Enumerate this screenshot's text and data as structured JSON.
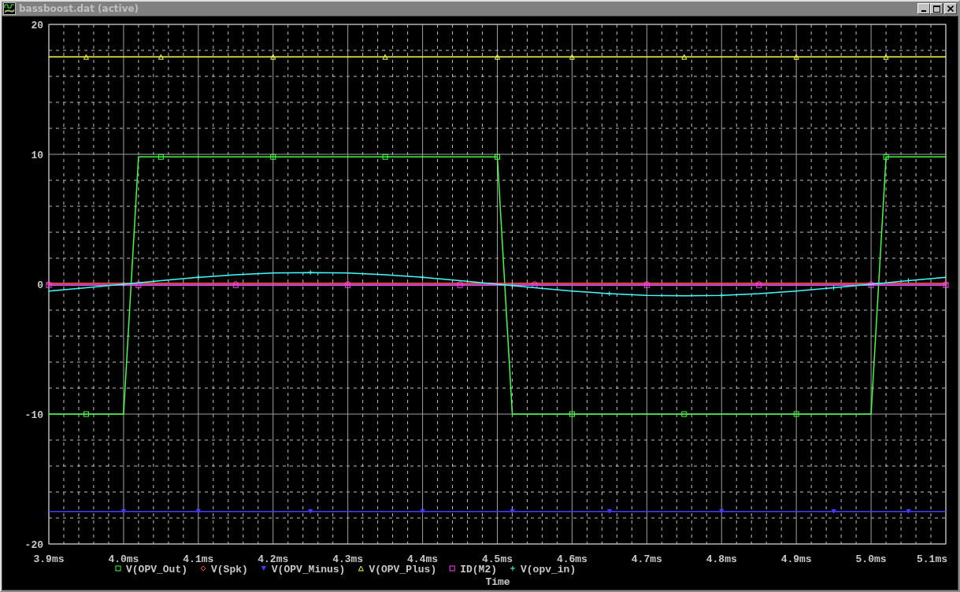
{
  "window": {
    "title": "bassboost.dat (active)"
  },
  "plot": {
    "chart_data": {
      "type": "line",
      "xlabel": "Time",
      "x": [
        3.9,
        3.95,
        4.0,
        4.02,
        4.05,
        4.1,
        4.15,
        4.2,
        4.25,
        4.3,
        4.35,
        4.4,
        4.45,
        4.5,
        4.52,
        4.55,
        4.6,
        4.65,
        4.7,
        4.75,
        4.8,
        4.85,
        4.9,
        4.95,
        5.0,
        5.02,
        5.05,
        5.1
      ],
      "series": [
        {
          "name": "V(OPV_Out)",
          "color": "#40ff40",
          "values": [
            -10,
            -10,
            -10,
            9.8,
            9.8,
            9.8,
            9.8,
            9.8,
            9.8,
            9.8,
            9.8,
            9.8,
            9.8,
            9.8,
            -10,
            -10,
            -10,
            -10,
            -10,
            -10,
            -10,
            -10,
            -10,
            -10,
            -10,
            9.8,
            9.8,
            9.8
          ]
        },
        {
          "name": "V(Spk)",
          "color": "#ff4040",
          "values": [
            0,
            0,
            0,
            0,
            0,
            0,
            0,
            0,
            0,
            0,
            0,
            0,
            0,
            0,
            0,
            0,
            0,
            0,
            0,
            0,
            0,
            0,
            0,
            0,
            0,
            0,
            0,
            0
          ]
        },
        {
          "name": "V(OPV_Minus)",
          "color": "#4040ff",
          "values": [
            -17.5,
            -17.5,
            -17.5,
            -17.5,
            -17.5,
            -17.5,
            -17.5,
            -17.5,
            -17.5,
            -17.5,
            -17.5,
            -17.5,
            -17.5,
            -17.5,
            -17.5,
            -17.5,
            -17.5,
            -17.5,
            -17.5,
            -17.5,
            -17.5,
            -17.5,
            -17.5,
            -17.5,
            -17.5,
            -17.5,
            -17.5,
            -17.5
          ]
        },
        {
          "name": "V(OPV_Plus)",
          "color": "#ffff40",
          "values": [
            17.5,
            17.5,
            17.5,
            17.5,
            17.5,
            17.5,
            17.5,
            17.5,
            17.5,
            17.5,
            17.5,
            17.5,
            17.5,
            17.5,
            17.5,
            17.5,
            17.5,
            17.5,
            17.5,
            17.5,
            17.5,
            17.5,
            17.5,
            17.5,
            17.5,
            17.5,
            17.5,
            17.5
          ]
        },
        {
          "name": "ID(M2)",
          "color": "#ff40ff",
          "values": [
            0,
            0,
            0,
            0,
            0,
            0,
            0,
            0,
            0,
            0,
            0,
            0,
            0,
            0,
            0,
            0,
            0,
            0,
            0,
            0,
            0,
            0,
            0,
            0,
            0,
            0,
            0,
            0
          ]
        },
        {
          "name": "V(opv_in)",
          "color": "#40ffff",
          "values": [
            -0.53,
            -0.28,
            0,
            0.11,
            0.28,
            0.53,
            0.73,
            0.86,
            0.9,
            0.86,
            0.73,
            0.53,
            0.28,
            0,
            -0.11,
            -0.28,
            -0.53,
            -0.73,
            -0.86,
            -0.9,
            -0.86,
            -0.73,
            -0.53,
            -0.28,
            0,
            0.11,
            0.28,
            0.53
          ]
        }
      ],
      "xlim": [
        3.9,
        5.1
      ],
      "ylim": [
        -20,
        20
      ],
      "xticks": [
        {
          "value": 3.9,
          "label": "3.9ms"
        },
        {
          "value": 4.0,
          "label": "4.0ms"
        },
        {
          "value": 4.1,
          "label": "4.1ms"
        },
        {
          "value": 4.2,
          "label": "4.2ms"
        },
        {
          "value": 4.3,
          "label": "4.3ms"
        },
        {
          "value": 4.4,
          "label": "4.4ms"
        },
        {
          "value": 4.5,
          "label": "4.5ms"
        },
        {
          "value": 4.6,
          "label": "4.6ms"
        },
        {
          "value": 4.7,
          "label": "4.7ms"
        },
        {
          "value": 4.8,
          "label": "4.8ms"
        },
        {
          "value": 4.9,
          "label": "4.9ms"
        },
        {
          "value": 5.0,
          "label": "5.0ms"
        },
        {
          "value": 5.1,
          "label": "5.1ms"
        }
      ],
      "yticks": [
        -20,
        -10,
        0,
        10,
        20
      ],
      "grid": true,
      "legend": true
    }
  }
}
